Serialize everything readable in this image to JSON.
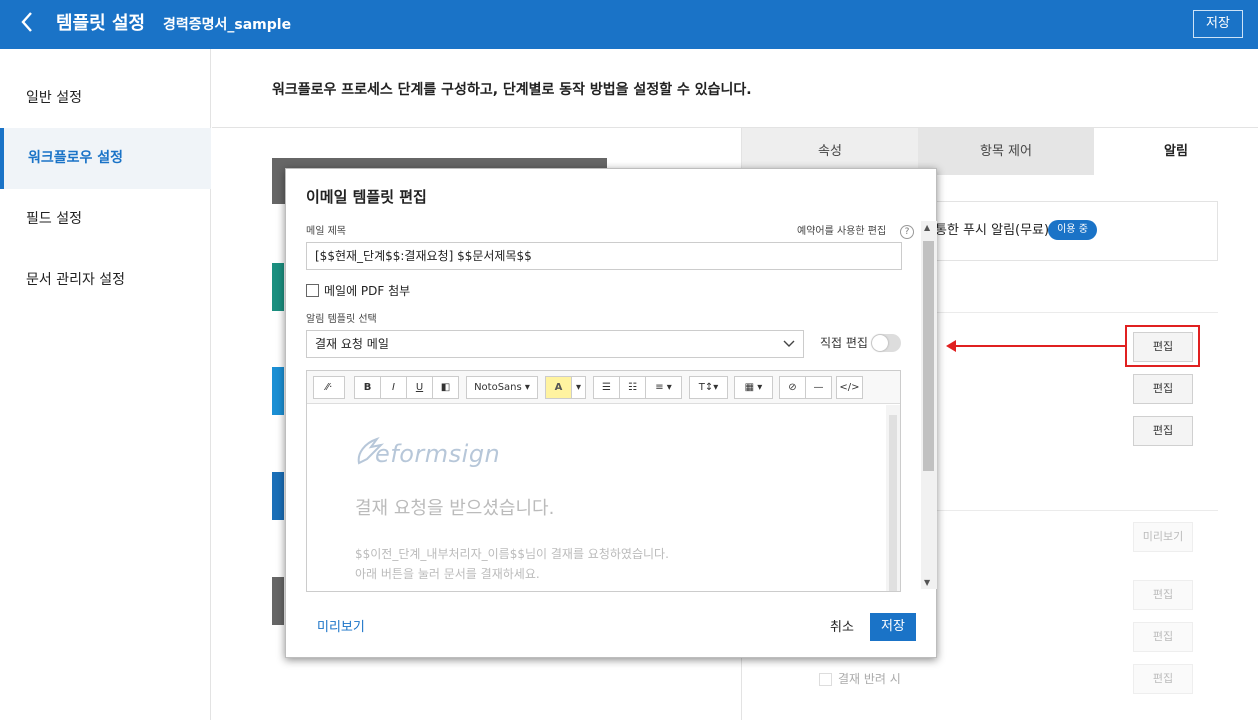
{
  "header": {
    "title": "템플릿 설정",
    "doc_name": "경력증명서_sample",
    "save_label": "저장",
    "back_icon": "chevron-left-icon"
  },
  "sidebar": {
    "items": [
      {
        "label": "일반 설정"
      },
      {
        "label": "워크플로우 설정",
        "active": true
      },
      {
        "label": "필드 설정"
      },
      {
        "label": "문서 관리자 설정"
      }
    ]
  },
  "main": {
    "description": "워크플로우 프로세스 단계를 구성하고, 단계별로 동작 방법을 설정할 수 있습니다."
  },
  "right_panel": {
    "tabs": [
      {
        "label": "속성"
      },
      {
        "label": "항목 제어"
      },
      {
        "label": "알림",
        "active": true
      }
    ],
    "push_label": "통한 푸시 알림(무료)",
    "push_badge": "이용 중",
    "edit_label": "편집",
    "preview_label": "미리보기",
    "reject_label": "결재 반려 시"
  },
  "modal": {
    "title": "이메일 템플릿 편집",
    "subject_label": "메일 제목",
    "reserved_label": "예약어를 사용한 편집",
    "help_icon": "?",
    "subject_value": "[$$현재_단계$$:결재요청] $$문서제목$$",
    "attach_pdf_label": "메일에 PDF 첨부",
    "template_label": "알림 템플릿 선택",
    "template_value": "결재 요청 메일",
    "direct_edit_label": "직접 편집",
    "toolbar": {
      "magic": "⁄⁄·",
      "bold": "B",
      "italic": "I",
      "underline": "U",
      "eraser": "◧",
      "font": "NotoSans ▾",
      "color": "A",
      "color_caret": "▾",
      "ul": "☰",
      "ol": "☷",
      "align": "≡ ▾",
      "height": "T↕▾",
      "table": "▦ ▾",
      "link": "⊘",
      "hr": "—",
      "code": "</>"
    },
    "editor": {
      "logo_text": "eformsign",
      "heading": "결재 요청을 받으셨습니다.",
      "line1": "$$이전_단계_내부처리자_이름$$님이 결재를 요청하였습니다.",
      "line2": "아래 버튼을 눌러 문서를 결재하세요."
    },
    "preview_label": "미리보기",
    "cancel_label": "취소",
    "save_label": "저장"
  },
  "colors": {
    "brand": "#1a73c7",
    "highlight": "#e02020"
  }
}
